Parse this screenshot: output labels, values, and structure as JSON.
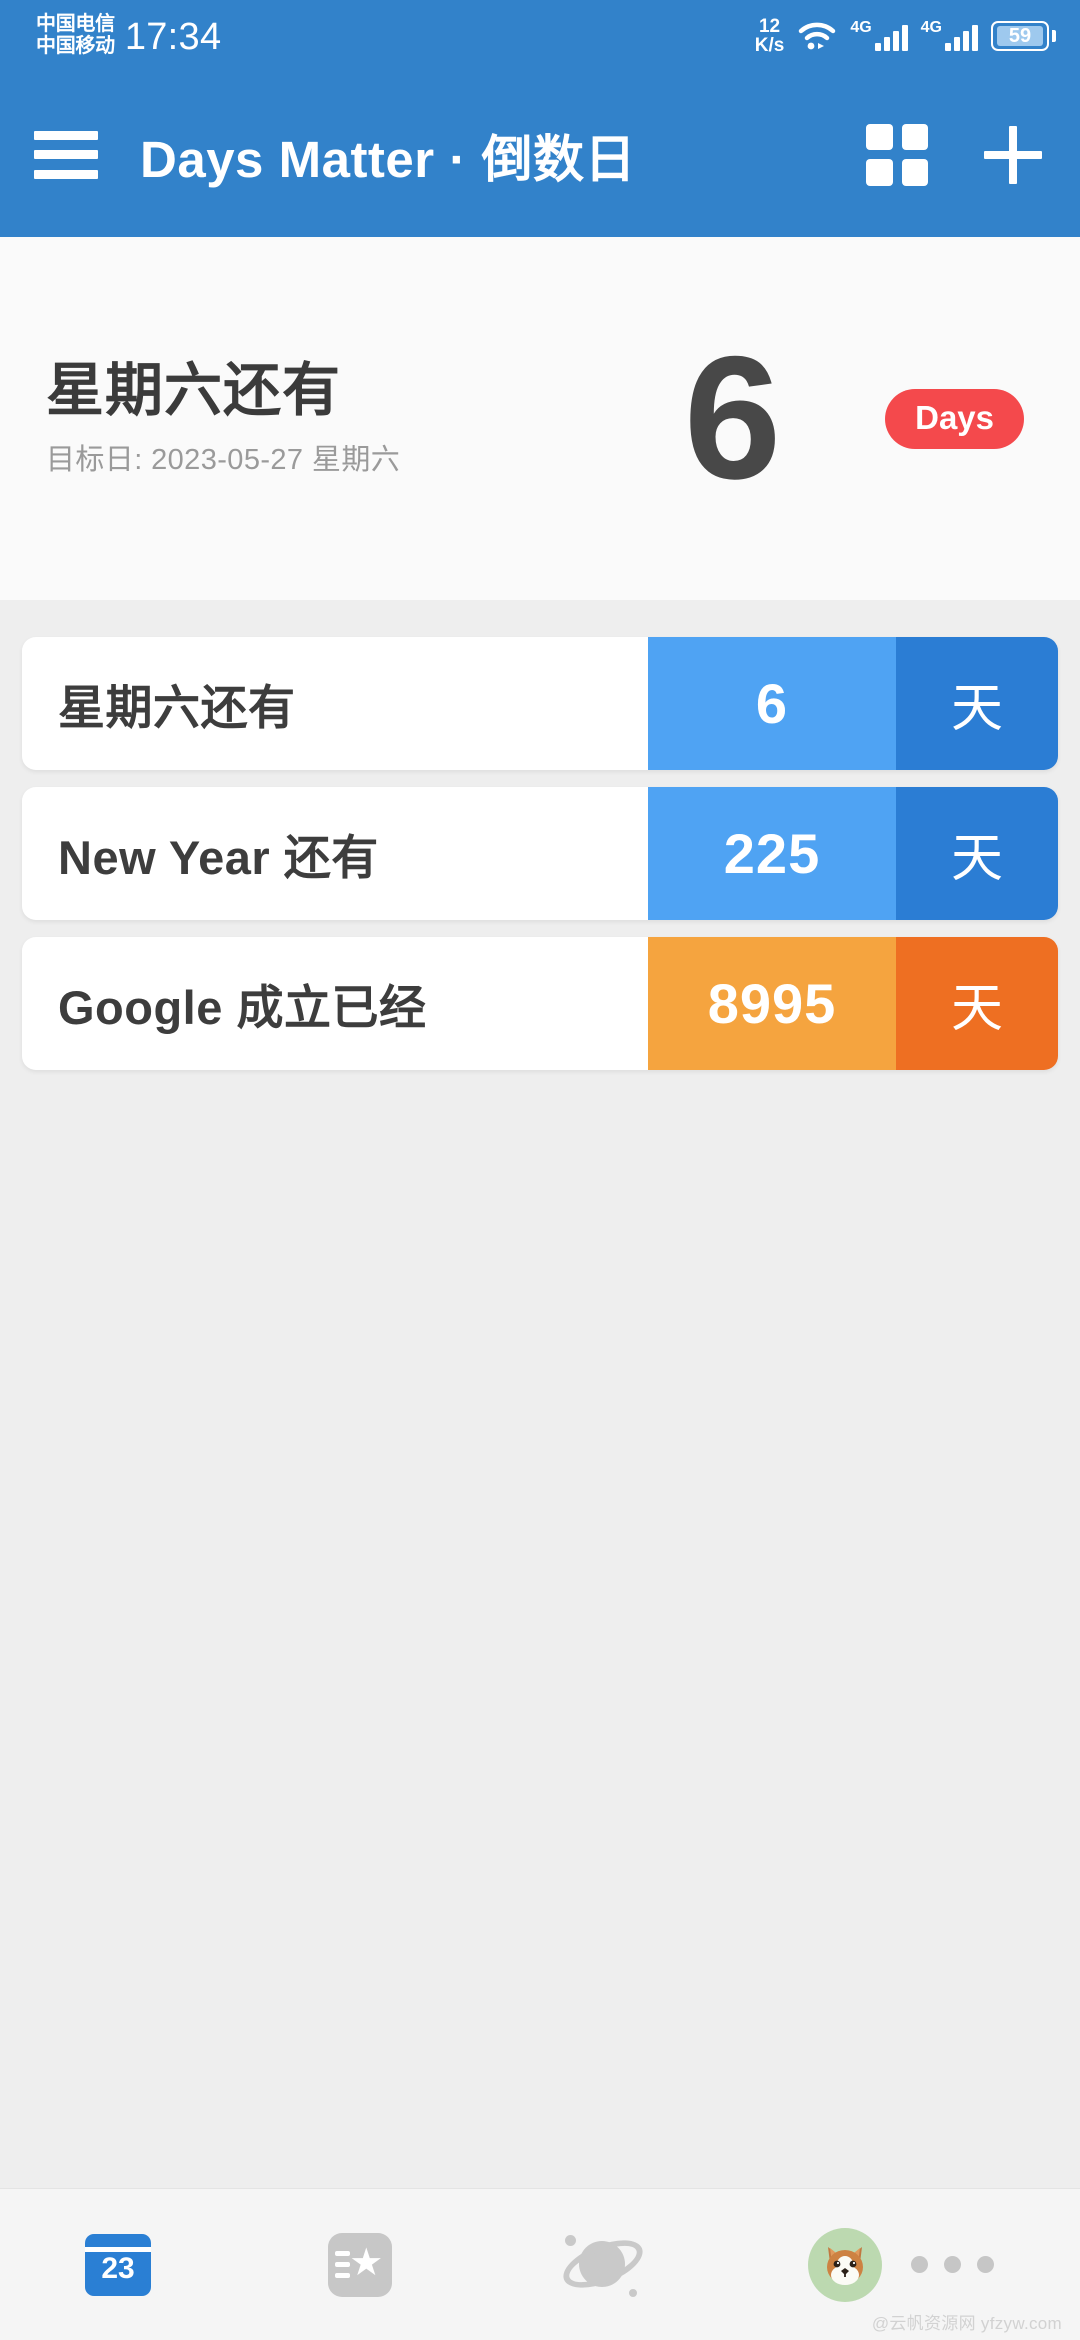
{
  "statusbar": {
    "carrier_primary": "中国电信",
    "carrier_secondary": "中国移动",
    "time": "17:34",
    "netspeed_value": "12",
    "netspeed_unit": "K/s",
    "wifi_icon": "wifi-icon",
    "signal1_label": "4G",
    "signal2_label": "4G",
    "battery_level": "59",
    "bar_color": "#3282ca"
  },
  "appbar": {
    "menu_icon": "hamburger-menu-icon",
    "title": "Days Matter · 倒数日",
    "grid_icon": "grid-view-icon",
    "add_icon": "plus-add-icon",
    "background": "#3282ca"
  },
  "hero": {
    "title": "星期六还有",
    "subtitle": "目标日: 2023-05-27 星期六",
    "number": "6",
    "badge": "Days",
    "badge_color": "#f4494c",
    "background": "#fafafa"
  },
  "list": {
    "rows": [
      {
        "title": "星期六还有",
        "number": "6",
        "unit": "天",
        "num_bg": "#4fa3f3",
        "unit_bg": "#2b7dd4"
      },
      {
        "title": "New Year 还有",
        "number": "225",
        "unit": "天",
        "num_bg": "#4fa3f3",
        "unit_bg": "#2b7dd4"
      },
      {
        "title": "Google 成立已经",
        "number": "8995",
        "unit": "天",
        "num_bg": "#f5a43f",
        "unit_bg": "#ee6f22"
      }
    ]
  },
  "bottomnav": {
    "items": [
      {
        "name": "calendar-icon",
        "label": "23",
        "active": true
      },
      {
        "name": "star-card-icon",
        "label": "",
        "active": false
      },
      {
        "name": "planet-icon",
        "label": "",
        "active": false
      },
      {
        "name": "dog-avatar-icon",
        "label": "",
        "active": false
      }
    ],
    "more_icon": "more-dots-icon"
  },
  "watermark": "@云帆资源网 yfzyw.com"
}
